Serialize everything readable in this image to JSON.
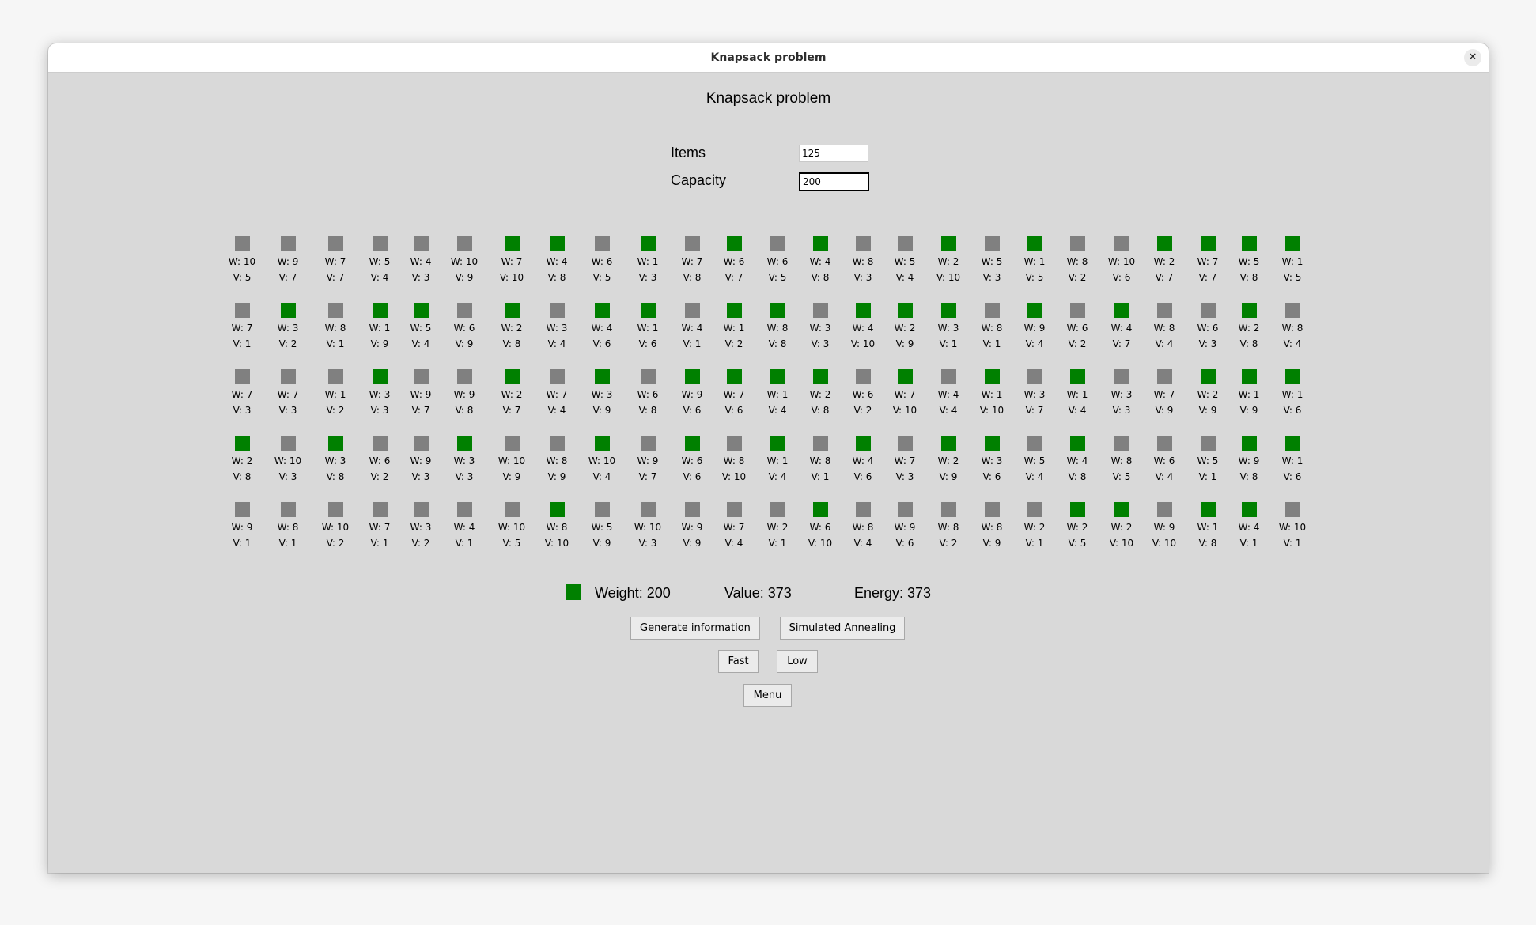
{
  "window": {
    "title": "Knapsack problem",
    "close_glyph": "✕"
  },
  "heading": "Knapsack problem",
  "form": {
    "items_label": "Items",
    "items_value": "125",
    "capacity_label": "Capacity",
    "capacity_value": "200"
  },
  "colors": {
    "selected": "#008000",
    "unselected": "#808080"
  },
  "items": [
    [
      [
        10,
        5,
        0
      ],
      [
        9,
        7,
        0
      ],
      [
        7,
        7,
        0
      ],
      [
        5,
        4,
        0
      ],
      [
        4,
        3,
        0
      ],
      [
        10,
        9,
        0
      ],
      [
        7,
        10,
        1
      ],
      [
        4,
        8,
        1
      ],
      [
        6,
        5,
        0
      ],
      [
        1,
        3,
        1
      ],
      [
        7,
        8,
        0
      ],
      [
        6,
        7,
        1
      ],
      [
        6,
        5,
        0
      ],
      [
        4,
        8,
        1
      ],
      [
        8,
        3,
        0
      ],
      [
        5,
        4,
        0
      ],
      [
        2,
        10,
        1
      ],
      [
        5,
        3,
        0
      ],
      [
        1,
        5,
        1
      ],
      [
        8,
        2,
        0
      ],
      [
        10,
        6,
        0
      ],
      [
        2,
        7,
        1
      ],
      [
        7,
        7,
        1
      ],
      [
        5,
        8,
        1
      ],
      [
        1,
        5,
        1
      ]
    ],
    [
      [
        7,
        1,
        0
      ],
      [
        3,
        2,
        1
      ],
      [
        8,
        1,
        0
      ],
      [
        1,
        9,
        1
      ],
      [
        5,
        4,
        1
      ],
      [
        6,
        9,
        0
      ],
      [
        2,
        8,
        1
      ],
      [
        3,
        4,
        0
      ],
      [
        4,
        6,
        1
      ],
      [
        1,
        6,
        1
      ],
      [
        4,
        1,
        0
      ],
      [
        1,
        2,
        1
      ],
      [
        8,
        8,
        1
      ],
      [
        3,
        3,
        0
      ],
      [
        4,
        10,
        1
      ],
      [
        2,
        9,
        1
      ],
      [
        3,
        1,
        1
      ],
      [
        8,
        1,
        0
      ],
      [
        9,
        4,
        1
      ],
      [
        6,
        2,
        0
      ],
      [
        4,
        7,
        1
      ],
      [
        8,
        4,
        0
      ],
      [
        6,
        3,
        0
      ],
      [
        2,
        8,
        1
      ],
      [
        8,
        4,
        0
      ]
    ],
    [
      [
        7,
        3,
        0
      ],
      [
        7,
        3,
        0
      ],
      [
        1,
        2,
        0
      ],
      [
        3,
        3,
        1
      ],
      [
        9,
        7,
        0
      ],
      [
        9,
        8,
        0
      ],
      [
        2,
        7,
        1
      ],
      [
        7,
        4,
        0
      ],
      [
        3,
        9,
        1
      ],
      [
        6,
        8,
        0
      ],
      [
        9,
        6,
        1
      ],
      [
        7,
        6,
        1
      ],
      [
        1,
        4,
        1
      ],
      [
        2,
        8,
        1
      ],
      [
        6,
        2,
        0
      ],
      [
        7,
        10,
        1
      ],
      [
        4,
        4,
        0
      ],
      [
        1,
        10,
        1
      ],
      [
        3,
        7,
        0
      ],
      [
        1,
        4,
        1
      ],
      [
        3,
        3,
        0
      ],
      [
        7,
        9,
        0
      ],
      [
        2,
        9,
        1
      ],
      [
        1,
        9,
        1
      ],
      [
        1,
        6,
        1
      ]
    ],
    [
      [
        2,
        8,
        1
      ],
      [
        10,
        3,
        0
      ],
      [
        3,
        8,
        1
      ],
      [
        6,
        2,
        0
      ],
      [
        9,
        3,
        0
      ],
      [
        3,
        3,
        1
      ],
      [
        10,
        9,
        0
      ],
      [
        8,
        9,
        0
      ],
      [
        10,
        4,
        1
      ],
      [
        9,
        7,
        0
      ],
      [
        6,
        6,
        1
      ],
      [
        8,
        10,
        0
      ],
      [
        1,
        4,
        1
      ],
      [
        8,
        1,
        0
      ],
      [
        4,
        6,
        1
      ],
      [
        7,
        3,
        0
      ],
      [
        2,
        9,
        1
      ],
      [
        3,
        6,
        1
      ],
      [
        5,
        4,
        0
      ],
      [
        4,
        8,
        1
      ],
      [
        8,
        5,
        0
      ],
      [
        6,
        4,
        0
      ],
      [
        5,
        1,
        0
      ],
      [
        9,
        8,
        1
      ],
      [
        1,
        6,
        1
      ]
    ],
    [
      [
        9,
        1,
        0
      ],
      [
        8,
        1,
        0
      ],
      [
        10,
        2,
        0
      ],
      [
        7,
        1,
        0
      ],
      [
        3,
        2,
        0
      ],
      [
        4,
        1,
        0
      ],
      [
        10,
        5,
        0
      ],
      [
        8,
        10,
        1
      ],
      [
        5,
        9,
        0
      ],
      [
        10,
        3,
        0
      ],
      [
        9,
        9,
        0
      ],
      [
        7,
        4,
        0
      ],
      [
        2,
        1,
        0
      ],
      [
        6,
        10,
        1
      ],
      [
        8,
        4,
        0
      ],
      [
        9,
        6,
        0
      ],
      [
        8,
        2,
        0
      ],
      [
        8,
        9,
        0
      ],
      [
        2,
        1,
        0
      ],
      [
        2,
        5,
        1
      ],
      [
        2,
        10,
        1
      ],
      [
        9,
        10,
        0
      ],
      [
        1,
        8,
        1
      ],
      [
        4,
        1,
        1
      ],
      [
        10,
        1,
        0
      ]
    ]
  ],
  "summary": {
    "weight": "Weight: 200",
    "value": "Value: 373",
    "energy": "Energy: 373"
  },
  "buttons": {
    "generate": "Generate information",
    "annealing": "Simulated Annealing",
    "fast": "Fast",
    "low": "Low",
    "menu": "Menu"
  }
}
